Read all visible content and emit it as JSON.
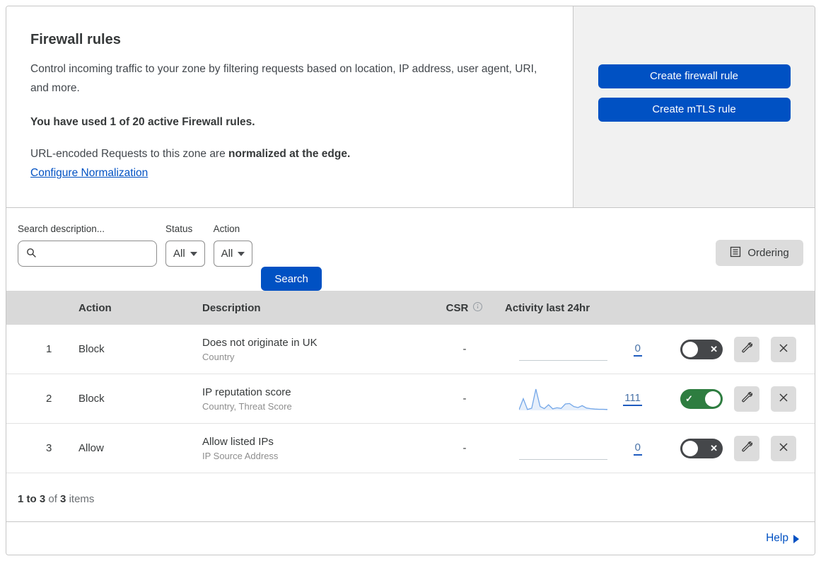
{
  "colors": {
    "accent_blue": "#0051c3",
    "toggle_on_green": "#2e7d40",
    "toggle_off_gray": "#45474a",
    "sparkline_blue": "#74a7e8",
    "panel_gray": "#f1f1f1",
    "table_header_gray": "#d9d9d9"
  },
  "icons": {
    "search": "magnifier-icon",
    "ordering": "list-document-icon",
    "csr_info": "info-circle-icon",
    "edit": "wrench-icon",
    "delete": "x-icon",
    "toggle_off_glyph": "x-mark",
    "toggle_on_glyph": "check-mark",
    "help": "right-triangle-icon",
    "dropdown": "caret-down-icon"
  },
  "header": {
    "title": "Firewall rules",
    "description": "Control incoming traffic to your zone by filtering requests based on location, IP address, user agent, URI, and more.",
    "usage": "You have used 1 of 20 active Firewall rules.",
    "normalization": {
      "prefix": "URL-encoded Requests to this zone are ",
      "bold": "normalized at the edge."
    },
    "link_label": "Configure Normalization",
    "buttons": {
      "create_firewall": "Create firewall rule",
      "create_mtls": "Create mTLS rule"
    }
  },
  "toolbar": {
    "search_label": "Search description...",
    "status_label": "Status",
    "status_value": "All",
    "action_label": "Action",
    "action_value": "All",
    "search_button": "Search",
    "ordering_button": "Ordering"
  },
  "table": {
    "headers": {
      "action": "Action",
      "description": "Description",
      "csr": "CSR",
      "activity": "Activity last 24hr"
    },
    "rows": [
      {
        "priority": "1",
        "action": "Block",
        "description": "Does not originate in UK",
        "match_fields": "Country",
        "csr": "-",
        "activity_count": "0",
        "enabled": false
      },
      {
        "priority": "2",
        "action": "Block",
        "description": "IP reputation score",
        "match_fields": "Country, Threat Score",
        "csr": "-",
        "activity_count": "111",
        "enabled": true
      },
      {
        "priority": "3",
        "action": "Allow",
        "description": "Allow listed IPs",
        "match_fields": "IP Source Address",
        "csr": "-",
        "activity_count": "0",
        "enabled": false
      }
    ]
  },
  "footer": {
    "range": "1 to 3",
    "of": "of",
    "total": "3",
    "items": "items"
  },
  "help": {
    "label": "Help"
  },
  "chart_data": {
    "type": "area",
    "title": "Activity last 24hr sparkline (rule 2: IP reputation score)",
    "x_range_hours": 24,
    "values": [
      3,
      55,
      4,
      10,
      100,
      18,
      8,
      26,
      7,
      12,
      9,
      30,
      32,
      18,
      13,
      22,
      11,
      8,
      6,
      5,
      5,
      4
    ],
    "total_requests": 111,
    "line_color": "#74a7e8",
    "fill_color": "rgba(116,167,232,0.18)",
    "flat_rows_values_note": "rows 1 and 3 show a flat zero-activity baseline"
  }
}
